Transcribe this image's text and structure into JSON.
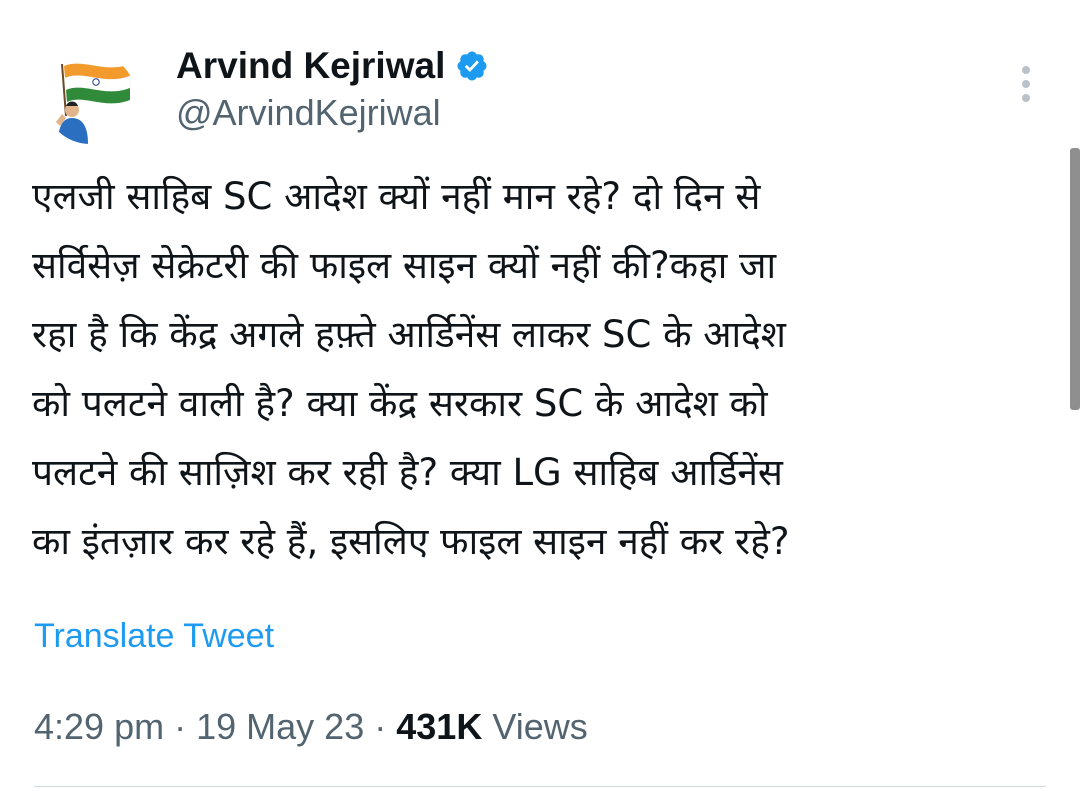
{
  "author": {
    "display_name": "Arvind Kejriwal",
    "handle": "@ArvindKejriwal",
    "verified": true,
    "avatar_icon": "avatar-with-indian-flag"
  },
  "tweet": {
    "lines": [
      "एलजी साहिब SC आदेश क्यों नहीं मान रहे? दो दिन से",
      "सर्विसेज़ सेक्रेटरी की फाइल साइन क्यों नहीं की?कहा जा",
      "रहा है कि केंद्र अगले हफ़्ते आर्डिनेंस लाकर SC के आदेश",
      "को पलटने वाली है? क्या केंद्र सरकार SC के आदेश को",
      "पलटने की साज़िश कर रही है? क्या LG साहिब आर्डिनेंस",
      "का इंतज़ार कर रहे हैं, इसलिए फाइल साइन नहीं कर रहे?"
    ],
    "translate_label": "Translate Tweet",
    "time": "4:29 pm",
    "date": "19 May 23",
    "separator": "·",
    "views_count": "431K",
    "views_label": "Views"
  },
  "colors": {
    "link": "#1d9bf0",
    "verified": "#1d9bf0",
    "secondary_text": "#536471",
    "primary_text": "#0f1419"
  }
}
